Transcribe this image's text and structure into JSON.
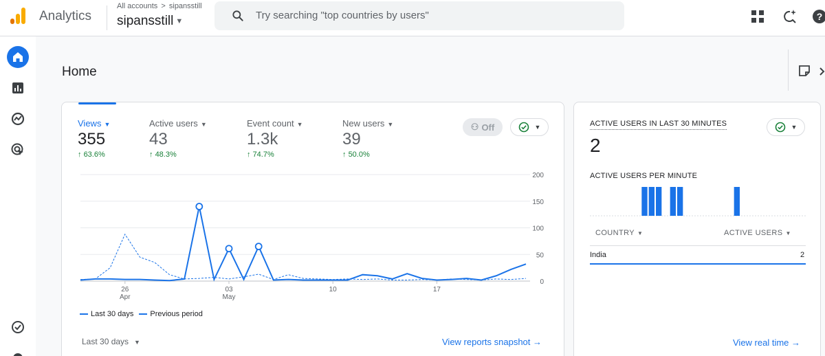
{
  "header": {
    "app_title": "Analytics",
    "breadcrumb_root": "All accounts",
    "breadcrumb_separator": ">",
    "breadcrumb_account": "sipansstill",
    "account_name": "sipansstill",
    "search_placeholder": "Try searching \"top countries by users\""
  },
  "icons": {
    "logo": "analytics-logo-icon",
    "search": "search-icon",
    "apps": "apps-grid-icon",
    "insights": "search-insights-icon",
    "help": "help-icon",
    "home": "home-icon",
    "reports": "reports-icon",
    "explore": "explore-icon",
    "advertising": "advertising-icon",
    "configure": "configure-icon",
    "admin": "settings-icon",
    "notes": "notes-icon"
  },
  "colors": {
    "accent": "#1a73e8",
    "positive": "#188038",
    "logo_orange": "#f9ab00",
    "logo_dark": "#e37400"
  },
  "page": {
    "title": "Home"
  },
  "overview": {
    "metrics": [
      {
        "label": "Views",
        "value": "355",
        "change": "63.6%",
        "selected": true
      },
      {
        "label": "Active users",
        "value": "43",
        "change": "48.3%",
        "selected": false
      },
      {
        "label": "Event count",
        "value": "1.3k",
        "change": "74.7%",
        "selected": false
      },
      {
        "label": "New users",
        "value": "39",
        "change": "50.0%",
        "selected": false
      }
    ],
    "toggle_label": "Off",
    "date_range_label": "Last 30 days",
    "snapshot_link": "View reports snapshot",
    "legend": {
      "current": "Last 30 days",
      "previous": "Previous period"
    }
  },
  "chart_data": [
    {
      "type": "line",
      "x": [
        1,
        2,
        3,
        4,
        5,
        6,
        7,
        8,
        9,
        10,
        11,
        12,
        13,
        14,
        15,
        16,
        17,
        18,
        19,
        20,
        21,
        22,
        23,
        24,
        25,
        26,
        27,
        28,
        29,
        30
      ],
      "x_tick_labels": [
        {
          "x": 4,
          "day": "26",
          "month": "Apr"
        },
        {
          "x": 11,
          "day": "03",
          "month": "May"
        },
        {
          "x": 18,
          "day": "10",
          "month": ""
        },
        {
          "x": 25,
          "day": "17",
          "month": ""
        }
      ],
      "series": [
        {
          "name": "Last 30 days",
          "style": "solid",
          "values": [
            2,
            4,
            4,
            3,
            3,
            2,
            1,
            4,
            140,
            3,
            61,
            3,
            65,
            2,
            3,
            2,
            2,
            2,
            2,
            12,
            10,
            4,
            14,
            5,
            2,
            3,
            5,
            2,
            10,
            22,
            32
          ]
        },
        {
          "name": "Previous period",
          "style": "dashed",
          "values": [
            3,
            4,
            25,
            88,
            45,
            35,
            12,
            4,
            5,
            7,
            4,
            8,
            13,
            3,
            12,
            5,
            4,
            3,
            4,
            3,
            4,
            2,
            2,
            3,
            2,
            4,
            3,
            2,
            4,
            3,
            5
          ]
        }
      ],
      "highlighted_points_series0": [
        8,
        10,
        12
      ],
      "y_ticks": [
        0,
        50,
        100,
        150,
        200
      ],
      "ylim": [
        0,
        200
      ],
      "y_axis_position": "right",
      "grid": true
    },
    {
      "type": "bar",
      "title": "ACTIVE USERS PER MINUTE",
      "x": [
        1,
        2,
        3,
        4,
        5,
        6,
        7,
        8,
        9,
        10,
        11,
        12,
        13,
        14,
        15,
        16,
        17,
        18,
        19,
        20,
        21,
        22,
        23,
        24,
        25,
        26,
        27,
        28,
        29,
        30
      ],
      "values": [
        0,
        0,
        0,
        0,
        0,
        0,
        0,
        0,
        0,
        1,
        0,
        0,
        0,
        0,
        0,
        0,
        0,
        1,
        1,
        0,
        1,
        1,
        1,
        0,
        0,
        0,
        0,
        0,
        0,
        0
      ],
      "direction": "right-to-left-time",
      "grid": false
    }
  ],
  "realtime": {
    "title": "ACTIVE USERS IN LAST 30 MINUTES",
    "value": "2",
    "per_minute_title": "ACTIVE USERS PER MINUTE",
    "col_country": "COUNTRY",
    "col_users": "ACTIVE USERS",
    "rows": [
      {
        "country": "India",
        "users": "2"
      }
    ],
    "link": "View real time"
  }
}
